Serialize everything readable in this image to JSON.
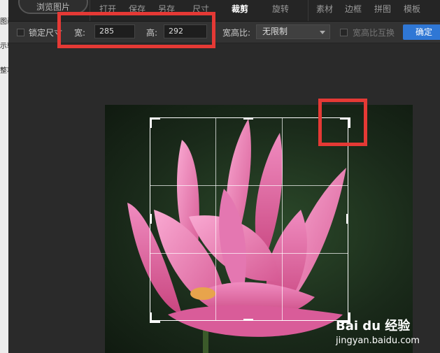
{
  "sidebar": {
    "fragments": [
      "图剥",
      "示驳",
      "整项"
    ]
  },
  "toolbar": {
    "browse_label": "浏览图片",
    "tabs": [
      "打开",
      "保存",
      "另存",
      "尺寸",
      "裁剪",
      "旋转",
      "素材",
      "边框",
      "拼图",
      "模板"
    ],
    "active_tab": "裁剪"
  },
  "crop": {
    "lock_label": "锁定尺寸",
    "width_label": "宽:",
    "width_value": "285",
    "height_label": "高:",
    "height_value": "292",
    "ratio_label": "宽高比:",
    "ratio_value": "无限制",
    "swap_label": "宽高比互换",
    "confirm_label": "确定"
  },
  "watermark": {
    "brand": "Bai du 经验",
    "url": "jingyan.baidu.com"
  },
  "colors": {
    "accent": "#2f77d5",
    "annotation": "#e53935",
    "petal": "#e06ca6"
  }
}
